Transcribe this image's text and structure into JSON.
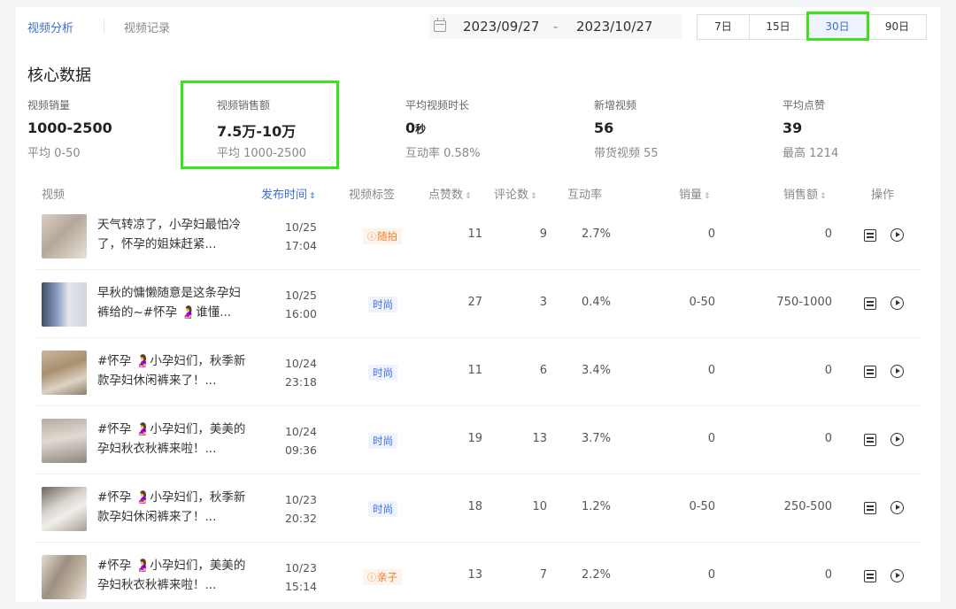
{
  "tabs": {
    "active": "视频分析",
    "inactive": "视频记录"
  },
  "date_range": {
    "start": "2023/09/27",
    "separator": "-",
    "end": "2023/10/27"
  },
  "range_buttons": [
    "7日",
    "15日",
    "30日",
    "90日"
  ],
  "range_selected": "30日",
  "core": {
    "title": "核心数据",
    "metrics": [
      {
        "label": "视频销量",
        "value": "1000-2500",
        "unit": "",
        "sub": "平均 0-50"
      },
      {
        "label": "视频销售额",
        "value": "7.5万-10万",
        "unit": "",
        "sub": "平均 1000-2500"
      },
      {
        "label": "平均视频时长",
        "value": "0",
        "unit": "秒",
        "sub": "互动率 0.58%"
      },
      {
        "label": "新增视频",
        "value": "56",
        "unit": "",
        "sub": "带货视频 55"
      },
      {
        "label": "平均点赞",
        "value": "39",
        "unit": "",
        "sub": "最高 1214"
      }
    ]
  },
  "table": {
    "headers": {
      "video": "视频",
      "publish_time": "发布时间",
      "tag": "视频标签",
      "likes": "点赞数",
      "comments": "评论数",
      "rate": "互动率",
      "sales": "销量",
      "amount": "销售额",
      "actions": "操作"
    },
    "rows": [
      {
        "title": "天气转凉了，小孕妇最怕冷了，怀孕的姐妹赶紧...",
        "date": "10/25",
        "time": "17:04",
        "tag": "随拍",
        "tag_color": "orange",
        "likes": "11",
        "comments": "9",
        "rate": "2.7%",
        "sales": "0",
        "amount": "0"
      },
      {
        "title": "早秋的慵懒随意是这条孕妇裤给的~#怀孕 🤰谁懂...",
        "date": "10/25",
        "time": "16:00",
        "tag": "时尚",
        "tag_color": "blue",
        "likes": "27",
        "comments": "3",
        "rate": "0.4%",
        "sales": "0-50",
        "amount": "750-1000"
      },
      {
        "title": "#怀孕 🤰小孕妇们，秋季新款孕妇休闲裤来了！...",
        "date": "10/24",
        "time": "23:18",
        "tag": "时尚",
        "tag_color": "blue",
        "likes": "11",
        "comments": "6",
        "rate": "3.4%",
        "sales": "0",
        "amount": "0"
      },
      {
        "title": "#怀孕 🤰小孕妇们，美美的孕妇秋衣秋裤来啦！...",
        "date": "10/24",
        "time": "09:36",
        "tag": "时尚",
        "tag_color": "blue",
        "likes": "19",
        "comments": "13",
        "rate": "3.7%",
        "sales": "0",
        "amount": "0"
      },
      {
        "title": "#怀孕 🤰小孕妇们，秋季新款孕妇休闲裤来了！...",
        "date": "10/23",
        "time": "20:32",
        "tag": "时尚",
        "tag_color": "blue",
        "likes": "18",
        "comments": "10",
        "rate": "1.2%",
        "sales": "0-50",
        "amount": "250-500"
      },
      {
        "title": "#怀孕 🤰小孕妇们，美美的孕妇秋衣秋裤来啦！...",
        "date": "10/23",
        "time": "15:14",
        "tag": "亲子",
        "tag_color": "orange",
        "likes": "13",
        "comments": "7",
        "rate": "2.2%",
        "sales": "0",
        "amount": "0"
      }
    ]
  },
  "colors": {
    "accent": "#3b6fd8",
    "tag_orange": "#f07d2b",
    "highlight": "#3be31a"
  }
}
